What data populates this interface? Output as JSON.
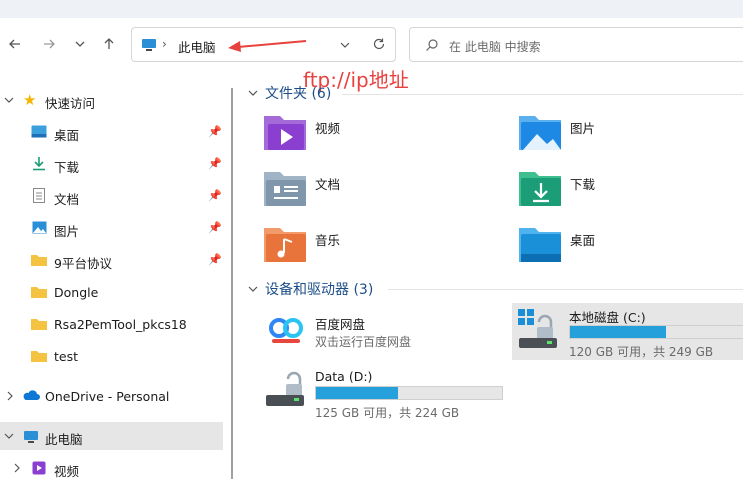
{
  "address": {
    "location": "此电脑"
  },
  "search": {
    "placeholder": "在 此电脑 中搜索"
  },
  "annotation": {
    "text": "ftp://ip地址",
    "color": "#e8423f"
  },
  "sidebar": {
    "quick_access": "快速访问",
    "items": [
      {
        "label": "桌面",
        "pinned": true
      },
      {
        "label": "下载",
        "pinned": true
      },
      {
        "label": "文档",
        "pinned": true
      },
      {
        "label": "图片",
        "pinned": true
      },
      {
        "label": "9平台协议",
        "pinned": true
      },
      {
        "label": "Dongle",
        "pinned": false
      },
      {
        "label": "Rsa2PemTool_pkcs18",
        "pinned": false
      },
      {
        "label": "test",
        "pinned": false
      }
    ],
    "onedrive": "OneDrive - Personal",
    "this_pc": "此电脑",
    "videos": "视频"
  },
  "folders_section": {
    "title": "文件夹 (6)",
    "items": [
      "视频",
      "图片",
      "文档",
      "下载",
      "音乐",
      "桌面"
    ]
  },
  "drives_section": {
    "title": "设备和驱动器 (3)",
    "baidu": {
      "name": "百度网盘",
      "sub": "双击运行百度网盘"
    },
    "local": {
      "name": "本地磁盘 (C:)",
      "space": "120 GB 可用，共 249 GB",
      "used_fraction": 0.518
    },
    "data": {
      "name": "Data (D:)",
      "space": "125 GB 可用，共 224 GB",
      "used_fraction": 0.442
    }
  },
  "colors": {
    "accent": "#26a0da",
    "folder_yellow": "#f5c342",
    "selection": "#e6e6e6"
  }
}
